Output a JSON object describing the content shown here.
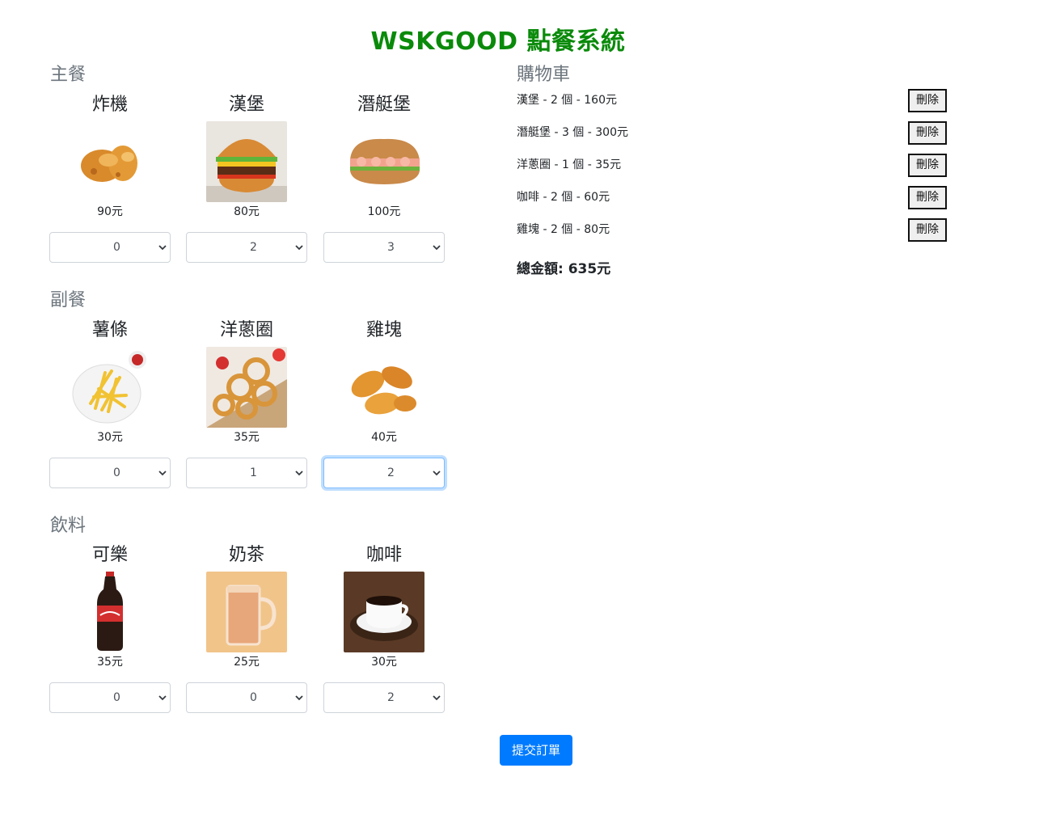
{
  "app_title": "WSKGOOD 點餐系統",
  "sections": [
    {
      "title": "主餐",
      "items": [
        {
          "name": "炸機",
          "price": "90元",
          "qty": "0"
        },
        {
          "name": "漢堡",
          "price": "80元",
          "qty": "2"
        },
        {
          "name": "潛艇堡",
          "price": "100元",
          "qty": "3"
        }
      ]
    },
    {
      "title": "副餐",
      "items": [
        {
          "name": "薯條",
          "price": "30元",
          "qty": "0"
        },
        {
          "name": "洋蔥圈",
          "price": "35元",
          "qty": "1"
        },
        {
          "name": "雞塊",
          "price": "40元",
          "qty": "2"
        }
      ]
    },
    {
      "title": "飲料",
      "items": [
        {
          "name": "可樂",
          "price": "35元",
          "qty": "0"
        },
        {
          "name": "奶茶",
          "price": "25元",
          "qty": "0"
        },
        {
          "name": "咖啡",
          "price": "30元",
          "qty": "2"
        }
      ]
    }
  ],
  "cart": {
    "title": "購物車",
    "items": [
      {
        "text": "漢堡 - 2 個 - 160元",
        "delete_label": "刪除"
      },
      {
        "text": "潛艇堡 - 3 個 - 300元",
        "delete_label": "刪除"
      },
      {
        "text": "洋蔥圈 - 1 個 - 35元",
        "delete_label": "刪除"
      },
      {
        "text": "咖啡 - 2 個 - 60元",
        "delete_label": "刪除"
      },
      {
        "text": "雞塊 - 2 個 - 80元",
        "delete_label": "刪除"
      }
    ],
    "total": "總金額: 635元"
  },
  "submit_label": "提交訂單",
  "colors": {
    "title": "#0a8a0a",
    "primary": "#007bff",
    "muted": "#6c757d"
  }
}
